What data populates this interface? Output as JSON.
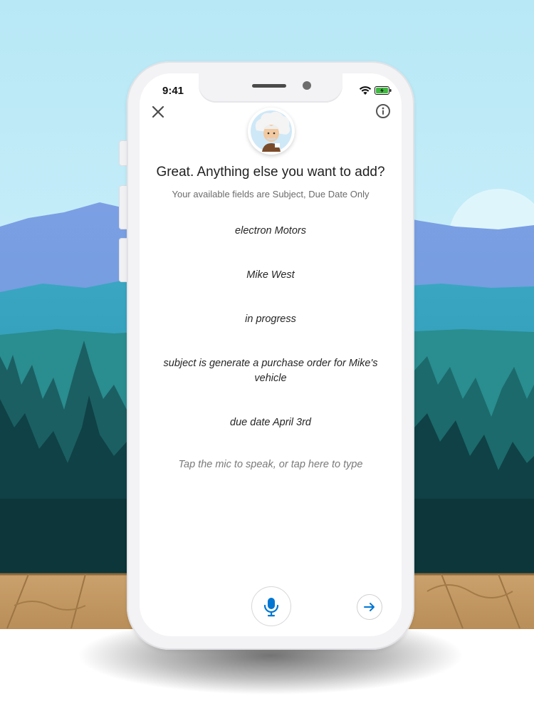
{
  "status_bar": {
    "time": "9:41"
  },
  "icons": {
    "close": "close-icon",
    "info": "info-icon",
    "avatar": "einstein-avatar",
    "mic": "microphone-icon",
    "send": "arrow-right-icon",
    "wifi": "wifi-icon",
    "battery": "battery-charging-icon"
  },
  "header": {
    "title": "Great. Anything else you want to add?",
    "subtitle": "Your available fields are Subject, Due Date Only"
  },
  "messages": [
    "electron Motors",
    "Mike West",
    "in progress",
    "subject is generate a purchase order for Mike's vehicle",
    "due date April 3rd"
  ],
  "input": {
    "prompt": "Tap the mic to speak, or tap here to type"
  },
  "colors": {
    "accent": "#0176d3",
    "sky": "#b9e8f6",
    "mountains_far": "#7a9fe0",
    "mountains_mid": "#2f9ab4",
    "forest_dark": "#0d3a3f",
    "deck_wood": "#c9a06b"
  }
}
